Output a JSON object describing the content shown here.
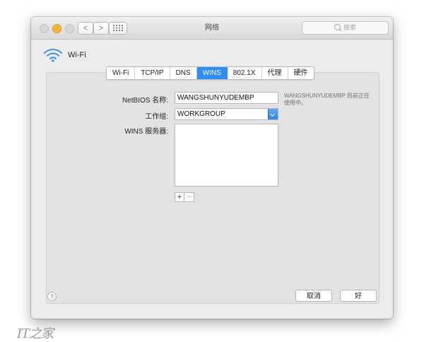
{
  "window": {
    "title": "网络",
    "search_placeholder": "搜索",
    "nav_back": "<",
    "nav_forward": ">"
  },
  "connection": {
    "name": "Wi-Fi"
  },
  "tabs": [
    {
      "label": "Wi-Fi",
      "active": false
    },
    {
      "label": "TCP/IP",
      "active": false
    },
    {
      "label": "DNS",
      "active": false
    },
    {
      "label": "WINS",
      "active": true
    },
    {
      "label": "802.1X",
      "active": false
    },
    {
      "label": "代理",
      "active": false
    },
    {
      "label": "硬件",
      "active": false
    }
  ],
  "wins": {
    "netbios_label": "NetBIOS 名称:",
    "netbios_value": "WANGSHUNYUDEMBP",
    "netbios_note": "WANGSHUNYUDEMBP 目前正在使用中。",
    "workgroup_label": "工作组:",
    "workgroup_value": "WORKGROUP",
    "servers_label": "WINS 服务器:",
    "add_label": "+",
    "remove_label": "−"
  },
  "footer": {
    "help_label": "?",
    "cancel_label": "取消",
    "ok_label": "好"
  },
  "watermark": "IT之家",
  "colors": {
    "accent": "#2f8ef6",
    "minimize": "#f5b63a"
  }
}
